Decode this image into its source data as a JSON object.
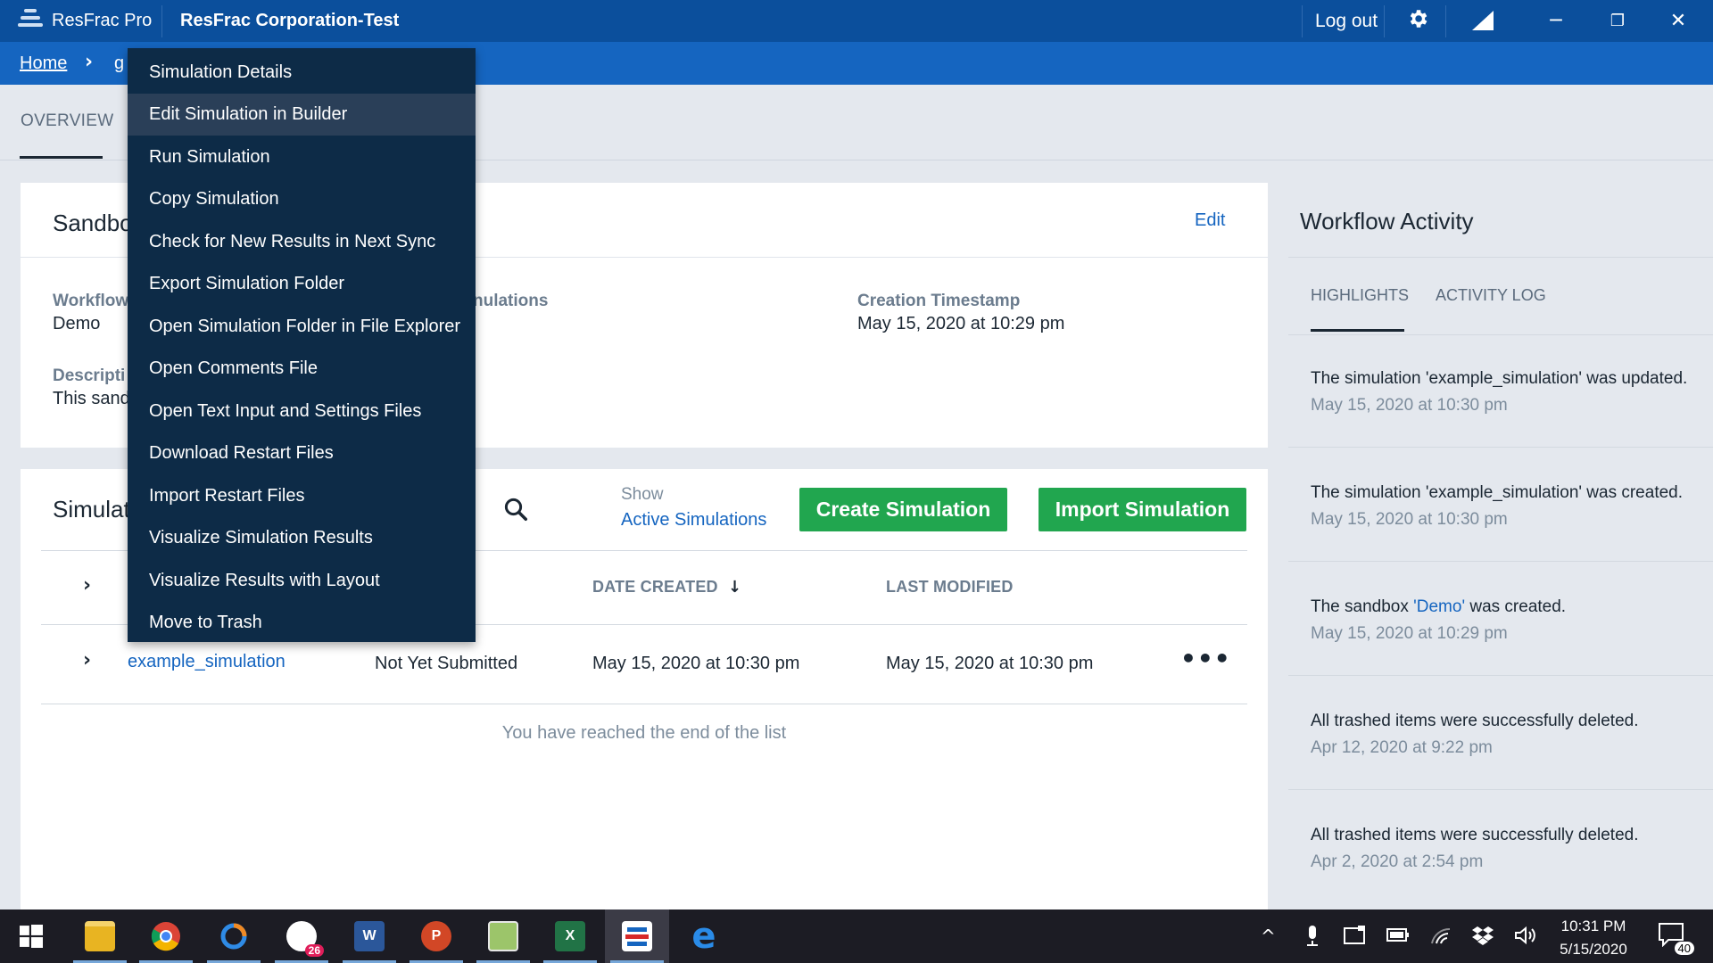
{
  "titlebar": {
    "app_name": "ResFrac Pro",
    "org_name": "ResFrac Corporation-Test",
    "logout_label": "Log out",
    "settings_icon": "gear-icon",
    "network_icon": "signal-icon",
    "minimize_glyph": "─",
    "restore_glyph": "❐",
    "close_glyph": "✕"
  },
  "breadcrumb": {
    "home": "Home",
    "separator": "›",
    "current": "g"
  },
  "tabs": {
    "overview": "OVERVIEW"
  },
  "sandbox": {
    "title": "Sandbo",
    "edit_label": "Edit",
    "workflow_label": "Workflow",
    "workflow_value": "Demo",
    "simulations_label": "nulations",
    "creation_label": "Creation Timestamp",
    "creation_value": "May 15, 2020 at 10:29 pm",
    "description_label": "Descripti",
    "description_value": "This sand"
  },
  "simulations": {
    "title": "Simulat",
    "show_label": "Show",
    "show_value": "Active Simulations",
    "create_button": "Create Simulation",
    "import_button": "Import Simulation",
    "columns": {
      "date_created": "DATE CREATED",
      "sort_arrow": "↓",
      "last_modified": "LAST MODIFIED"
    },
    "rows": [
      {
        "name": "example_simulation",
        "status": "Not Yet Submitted",
        "date_created": "May 15, 2020 at 10:30 pm",
        "last_modified": "May 15, 2020 at 10:30 pm",
        "more": "•••"
      }
    ],
    "end_note": "You have reached the end of the list"
  },
  "activity": {
    "title": "Workflow Activity",
    "tabs": [
      "HIGHLIGHTS",
      "ACTIVITY LOG"
    ],
    "items": [
      {
        "prefix": "The simulation 'example_simulation' was updated.",
        "highlight": "",
        "suffix": "",
        "date": "May 15, 2020 at 10:30 pm"
      },
      {
        "prefix": "The simulation 'example_simulation' was created.",
        "highlight": "",
        "suffix": "",
        "date": "May 15, 2020 at 10:30 pm"
      },
      {
        "prefix": "The sandbox ",
        "highlight": "'Demo'",
        "suffix": " was created.",
        "date": "May 15, 2020 at 10:29 pm"
      },
      {
        "prefix": "All trashed items were successfully deleted.",
        "highlight": "",
        "suffix": "",
        "date": "Apr 12, 2020 at 9:22 pm"
      },
      {
        "prefix": "All trashed items were successfully deleted.",
        "highlight": "",
        "suffix": "",
        "date": "Apr 2, 2020 at 2:54 pm"
      }
    ]
  },
  "context_menu": {
    "items": [
      "Simulation Details",
      "Edit Simulation in Builder",
      "Run Simulation",
      "Copy Simulation",
      "Check for New Results in Next Sync",
      "Export Simulation Folder",
      "Open Simulation Folder in File Explorer",
      "Open Comments File",
      "Open Text Input and Settings Files",
      "Download Restart Files",
      "Import Restart Files",
      "Visualize Simulation Results",
      "Visualize Results with Layout",
      "Move to Trash"
    ],
    "hover_index": 1
  },
  "taskbar": {
    "apps": [
      {
        "name": "windows-start-icon",
        "label": ""
      },
      {
        "name": "file-explorer-icon",
        "label": ""
      },
      {
        "name": "chrome-icon",
        "label": ""
      },
      {
        "name": "app-ring-icon",
        "label": ""
      },
      {
        "name": "slack-icon",
        "label": "26"
      },
      {
        "name": "word-icon",
        "label": "W"
      },
      {
        "name": "powerpoint-icon",
        "label": "P"
      },
      {
        "name": "notepad-icon",
        "label": ""
      },
      {
        "name": "excel-icon",
        "label": "X"
      },
      {
        "name": "resfrac-icon",
        "label": ""
      },
      {
        "name": "edge-icon",
        "label": "e"
      }
    ],
    "time": "10:31 PM",
    "date": "5/15/2020",
    "notification_count": "40",
    "tray_up": "^"
  }
}
